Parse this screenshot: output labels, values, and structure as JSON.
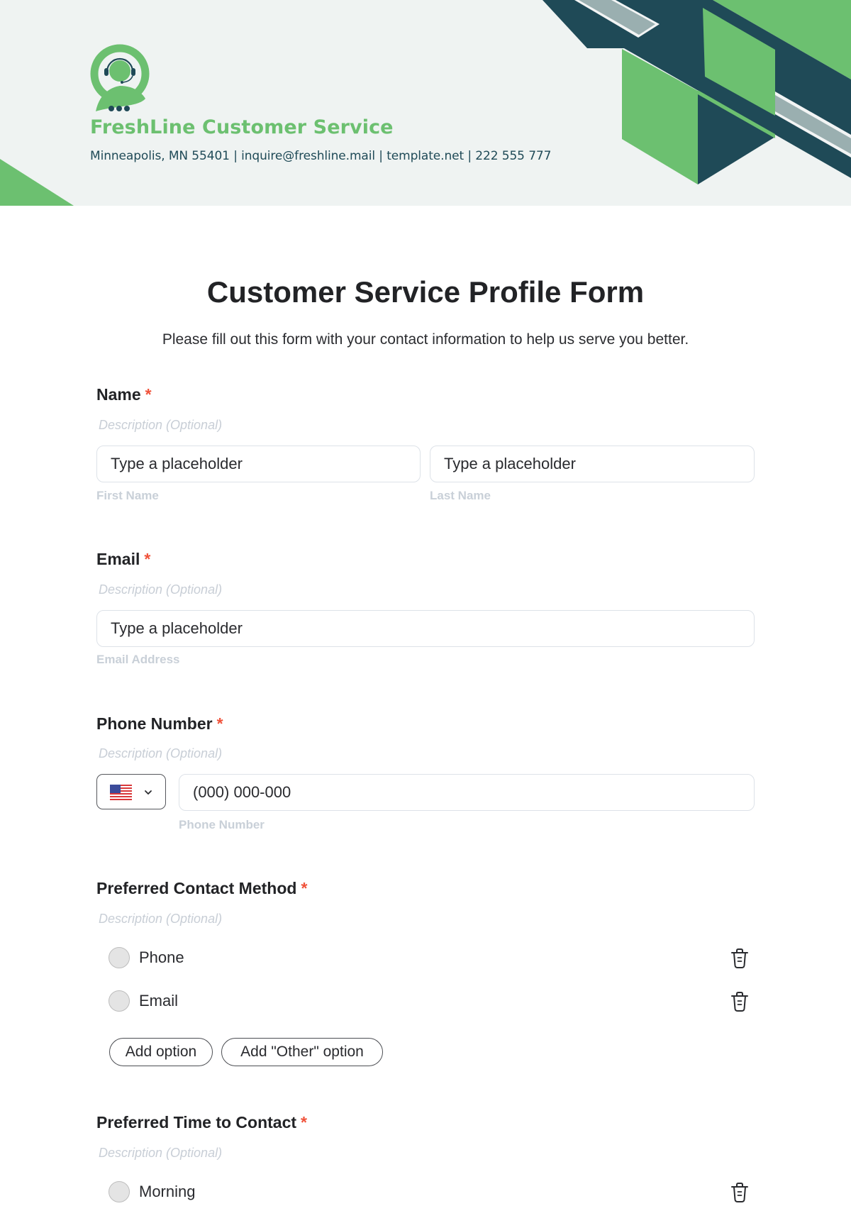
{
  "header": {
    "company_name": "FreshLine Customer Service",
    "contact_line": "Minneapolis, MN 55401 | inquire@freshline.mail | template.net | 222 555 777",
    "logo_icon": "headset-agent-chat-icon",
    "colors": {
      "green": "#6cc070",
      "dark_teal": "#1f4a57",
      "gray_stripe": "#9aafb0",
      "background": "#eff3f2"
    }
  },
  "form": {
    "title": "Customer Service Profile Form",
    "subtitle": "Please fill out this form with your contact information to help us serve you better.",
    "required_marker": "*",
    "questions": {
      "name": {
        "label": "Name",
        "description_placeholder": "Description (Optional)",
        "first": {
          "placeholder": "Type a placeholder",
          "sublabel": "First Name"
        },
        "last": {
          "placeholder": "Type a placeholder",
          "sublabel": "Last Name"
        }
      },
      "email": {
        "label": "Email",
        "description_placeholder": "Description (Optional)",
        "placeholder": "Type a placeholder",
        "sublabel": "Email Address"
      },
      "phone": {
        "label": "Phone Number",
        "description_placeholder": "Description (Optional)",
        "country": "US",
        "country_icon": "us-flag-icon",
        "placeholder": "(000) 000-000",
        "sublabel": "Phone Number"
      },
      "contact_method": {
        "label": "Preferred Contact Method",
        "description_placeholder": "Description (Optional)",
        "options": [
          {
            "label": "Phone"
          },
          {
            "label": "Email"
          }
        ],
        "add_option_label": "Add option",
        "add_other_label": "Add \"Other\" option"
      },
      "contact_time": {
        "label": "Preferred Time to Contact",
        "description_placeholder": "Description (Optional)",
        "options": [
          {
            "label": "Morning"
          }
        ]
      }
    }
  }
}
